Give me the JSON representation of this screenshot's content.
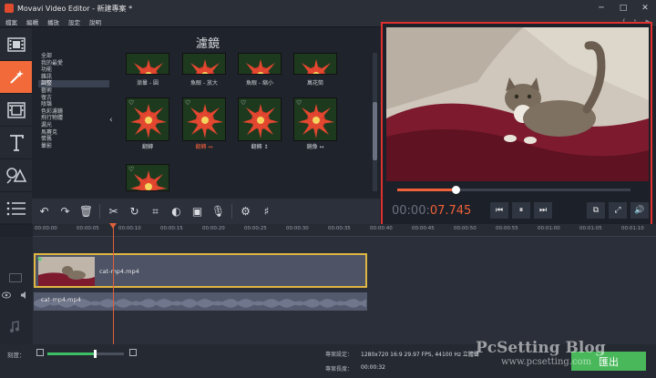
{
  "window": {
    "title": "Movavi Video Editor - 新建專案 *",
    "controls": [
      "─",
      "□",
      "✕"
    ]
  },
  "menubar": {
    "items": [
      "檔案",
      "編輯",
      "播放",
      "設定",
      "說明"
    ],
    "right_icons": [
      "facebook-icon",
      "twitter-icon",
      "youtube-icon"
    ]
  },
  "toolstrip": {
    "tools": [
      {
        "name": "import-tool",
        "icon": "film-strip-icon",
        "active": false
      },
      {
        "name": "filters-tool",
        "icon": "magic-wand-icon",
        "active": true
      },
      {
        "name": "transitions-tool",
        "icon": "transition-icon",
        "active": false
      },
      {
        "name": "titles-tool",
        "icon": "text-icon",
        "active": false
      },
      {
        "name": "stickers-tool",
        "icon": "shapes-icon",
        "active": false
      },
      {
        "name": "more-tool",
        "icon": "list-icon",
        "active": false
      }
    ]
  },
  "filters_panel": {
    "title": "濾鏡",
    "categories": [
      "全部",
      "我的最愛",
      "功能",
      "雜訊",
      "調整",
      "藝術",
      "復古",
      "陰翳",
      "色彩濾鏡",
      "飛行物體",
      "漏光",
      "馬賽克",
      "懷舊",
      "暈影"
    ],
    "selected_category": "調整",
    "nav_arrow": "‹",
    "filters": [
      {
        "label": "漸暈 - 圓",
        "favorite": false,
        "highlighted": false
      },
      {
        "label": "魚眼 - 放大",
        "favorite": false,
        "highlighted": false
      },
      {
        "label": "魚眼 - 縮小",
        "favorite": false,
        "highlighted": false
      },
      {
        "label": "萬花筒",
        "favorite": false,
        "highlighted": false
      },
      {
        "label": "翻轉",
        "favorite": true,
        "highlighted": false
      },
      {
        "label": "翻轉 ↔",
        "favorite": true,
        "highlighted": true
      },
      {
        "label": "翻轉 ↕",
        "favorite": true,
        "highlighted": false
      },
      {
        "label": "鏡像 ↔",
        "favorite": true,
        "highlighted": false
      },
      {
        "label": "",
        "favorite": true,
        "highlighted": false
      }
    ]
  },
  "edit_toolbar": {
    "buttons": [
      {
        "name": "undo-button",
        "icon": "undo-icon",
        "glyph": "↶"
      },
      {
        "name": "redo-button",
        "icon": "redo-icon",
        "glyph": "↷"
      },
      {
        "name": "delete-button",
        "icon": "trash-icon",
        "glyph": "🗑"
      },
      {
        "name": "cut-button",
        "icon": "scissors-icon",
        "glyph": "✂"
      },
      {
        "name": "rotate-button",
        "icon": "rotate-icon",
        "glyph": "↻"
      },
      {
        "name": "crop-button",
        "icon": "crop-icon",
        "glyph": "⌗"
      },
      {
        "name": "color-button",
        "icon": "contrast-icon",
        "glyph": "◐"
      },
      {
        "name": "image-button",
        "icon": "image-icon",
        "glyph": "▣"
      },
      {
        "name": "record-button",
        "icon": "microphone-icon",
        "glyph": "🎙"
      },
      {
        "name": "settings-button",
        "icon": "gear-icon",
        "glyph": "⚙"
      },
      {
        "name": "equalizer-button",
        "icon": "equalizer-icon",
        "glyph": "♯"
      }
    ]
  },
  "player": {
    "timecode_dim": "00:00:",
    "timecode_highlight": "07.745",
    "progress": 0.25,
    "controls": [
      {
        "name": "previous-frame-button",
        "icon": "skip-back-icon",
        "glyph": "⏮"
      },
      {
        "name": "pause-button",
        "icon": "pause-icon",
        "glyph": "⏸"
      },
      {
        "name": "next-frame-button",
        "icon": "skip-forward-icon",
        "glyph": "⏭"
      }
    ],
    "right_controls": [
      {
        "name": "detach-button",
        "icon": "external-icon",
        "glyph": "⧉"
      },
      {
        "name": "fullscreen-button",
        "icon": "fullscreen-icon",
        "glyph": "⤢"
      },
      {
        "name": "volume-button",
        "icon": "volume-icon",
        "glyph": "🔊"
      }
    ]
  },
  "timeline": {
    "ruler_labels": [
      "00:00:00",
      "00:00:05",
      "00:00:10",
      "00:00:15",
      "00:00:20",
      "00:00:25",
      "00:00:30",
      "00:00:35",
      "00:00:40",
      "00:00:45",
      "00:00:50",
      "00:00:55",
      "00:01:00",
      "00:01:05",
      "00:01:10"
    ],
    "video_clip": {
      "name": "cat-mp4.mp4",
      "favorite_icon": "★"
    },
    "audio_clip": {
      "name": "cat-mp4.mp4"
    }
  },
  "bottombar": {
    "zoom_label": "刻度：",
    "zoom_level": 0.62,
    "project_settings_label": "專案設定：",
    "project_settings_value": "1280x720 16:9 29.97 FPS, 44100 Hz 立體聲",
    "project_length_label": "專案長度：",
    "project_length_value": "00:00:32",
    "export_label": "匯出"
  },
  "watermark": {
    "line1": "PcSetting Blog",
    "line2": "www.pcsetting.com"
  },
  "colors": {
    "accent": "#f26a3a",
    "highlight_border": "#e0312f",
    "clip_border": "#e0b642",
    "export": "#49b85b"
  }
}
